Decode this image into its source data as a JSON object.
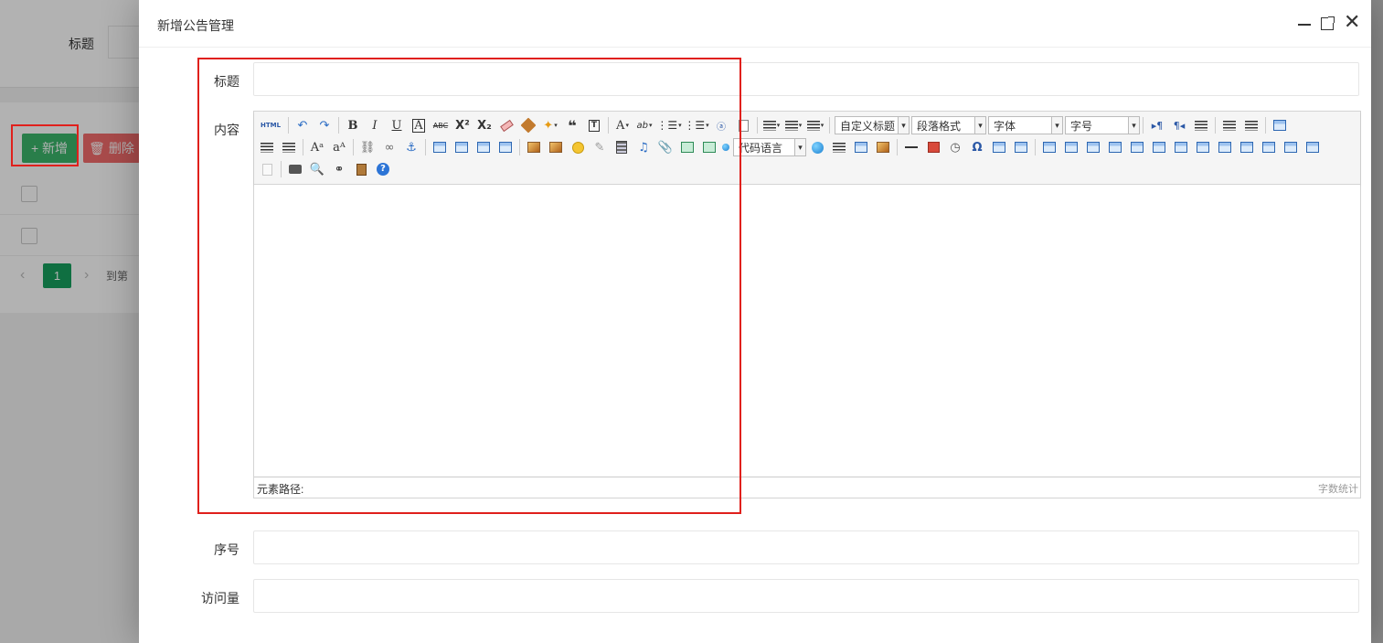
{
  "background": {
    "search_label": "标题",
    "add_button": "+ 新增",
    "delete_button": "🗑 删除",
    "pager": {
      "prev": "‹",
      "current_page": "1",
      "next": "›",
      "goto_label": "到第"
    }
  },
  "dialog": {
    "title": "新增公告管理",
    "controls": {
      "minimize": "minimize",
      "maximize": "maximize",
      "close": "✕"
    },
    "fields": {
      "title_label": "标题",
      "content_label": "内容",
      "order_label": "序号",
      "views_label": "访问量"
    },
    "editor": {
      "toolbar": {
        "source": "HTML",
        "code_language_select": "代码语言",
        "heading_select": "自定义标题",
        "paragraph_select": "段落格式",
        "font_family_select": "字体",
        "font_size_select": "字号"
      },
      "status": {
        "element_path_label": "元素路径:",
        "word_count_label": "字数统计"
      }
    }
  },
  "colors": {
    "highlight": "#e0201c",
    "add_green": "#3bb56a",
    "delete_red": "#f36c6c",
    "page_green": "#16a05d"
  }
}
